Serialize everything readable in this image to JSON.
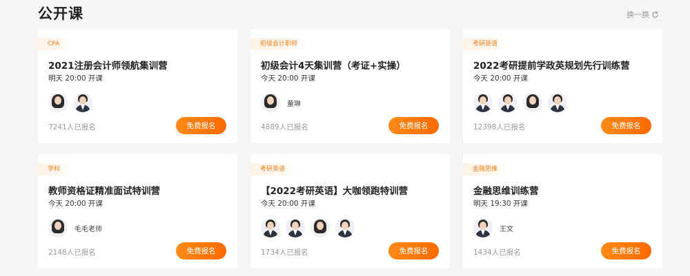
{
  "section": {
    "title": "公开课",
    "refresh_label": "换一换"
  },
  "courses": [
    {
      "tag": "CPA",
      "title": "2021注册会计师领航集训营",
      "time": "明天 20:00 开课",
      "teachers": [
        {
          "name": "",
          "gender": "female"
        },
        {
          "name": "",
          "gender": "male"
        }
      ],
      "count": "7241人已报名",
      "button": "免费报名"
    },
    {
      "tag": "初级会计职称",
      "title": "初级会计4天集训营（考证+实操）",
      "time": "今天 20:00 开课",
      "teachers": [
        {
          "name": "童琳",
          "gender": "female"
        }
      ],
      "count": "4889人已报名",
      "button": "免费报名"
    },
    {
      "tag": "考研英语",
      "title": "2022考研提前学政英规划先行训练营",
      "time": "今天 20:00 开课",
      "teachers": [
        {
          "name": "",
          "gender": "male"
        },
        {
          "name": "",
          "gender": "male"
        },
        {
          "name": "",
          "gender": "female"
        },
        {
          "name": "",
          "gender": "male"
        }
      ],
      "count": "12398人已报名",
      "button": "免费报名"
    },
    {
      "tag": "学科",
      "title": "教师资格证精准面试特训营",
      "time": "今天 20:00 开课",
      "teachers": [
        {
          "name": "毛毛老师",
          "gender": "female"
        }
      ],
      "count": "2148人已报名",
      "button": "免费报名"
    },
    {
      "tag": "考研英语",
      "title": "【2022考研英语】大咖领跑特训营",
      "time": "今天 20:00 开课",
      "teachers": [
        {
          "name": "",
          "gender": "male"
        },
        {
          "name": "",
          "gender": "male"
        },
        {
          "name": "",
          "gender": "female"
        },
        {
          "name": "",
          "gender": "male"
        }
      ],
      "count": "1734人已报名",
      "button": "免费报名"
    },
    {
      "tag": "金融思维",
      "title": "金融思维训练营",
      "time": "明天 19:30 开课",
      "teachers": [
        {
          "name": "王文",
          "gender": "male"
        }
      ],
      "count": "1434人已报名",
      "button": "免费报名"
    }
  ],
  "colors": {
    "accent": "#ff7a0e",
    "tag_text": "#f07e1b",
    "background": "#f5f5f5"
  },
  "icons": {
    "refresh": "refresh-icon"
  }
}
